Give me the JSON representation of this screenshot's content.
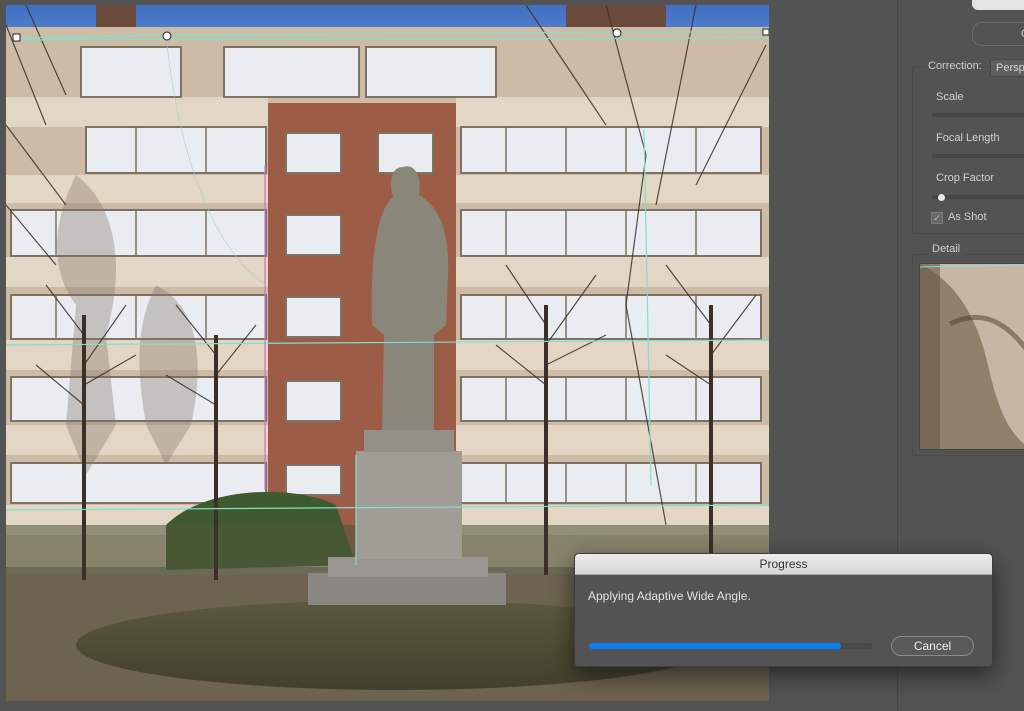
{
  "panel": {
    "top_button_label": "",
    "second_button_label": "C",
    "correction": {
      "label": "Correction:",
      "value": "Persp"
    },
    "scale_label": "Scale",
    "focal_length_label": "Focal Length",
    "crop_factor_label": "Crop Factor",
    "as_shot_label": "As Shot",
    "as_shot_checked": true,
    "detail_label": "Detail"
  },
  "progress": {
    "title": "Progress",
    "message": "Applying Adaptive Wide Angle.",
    "value": 0.89,
    "cancel_label": "Cancel"
  },
  "colors": {
    "accent": "#0d7df6",
    "guide_line": "#7fe0d0",
    "constraint_line": "#d86ad8"
  }
}
